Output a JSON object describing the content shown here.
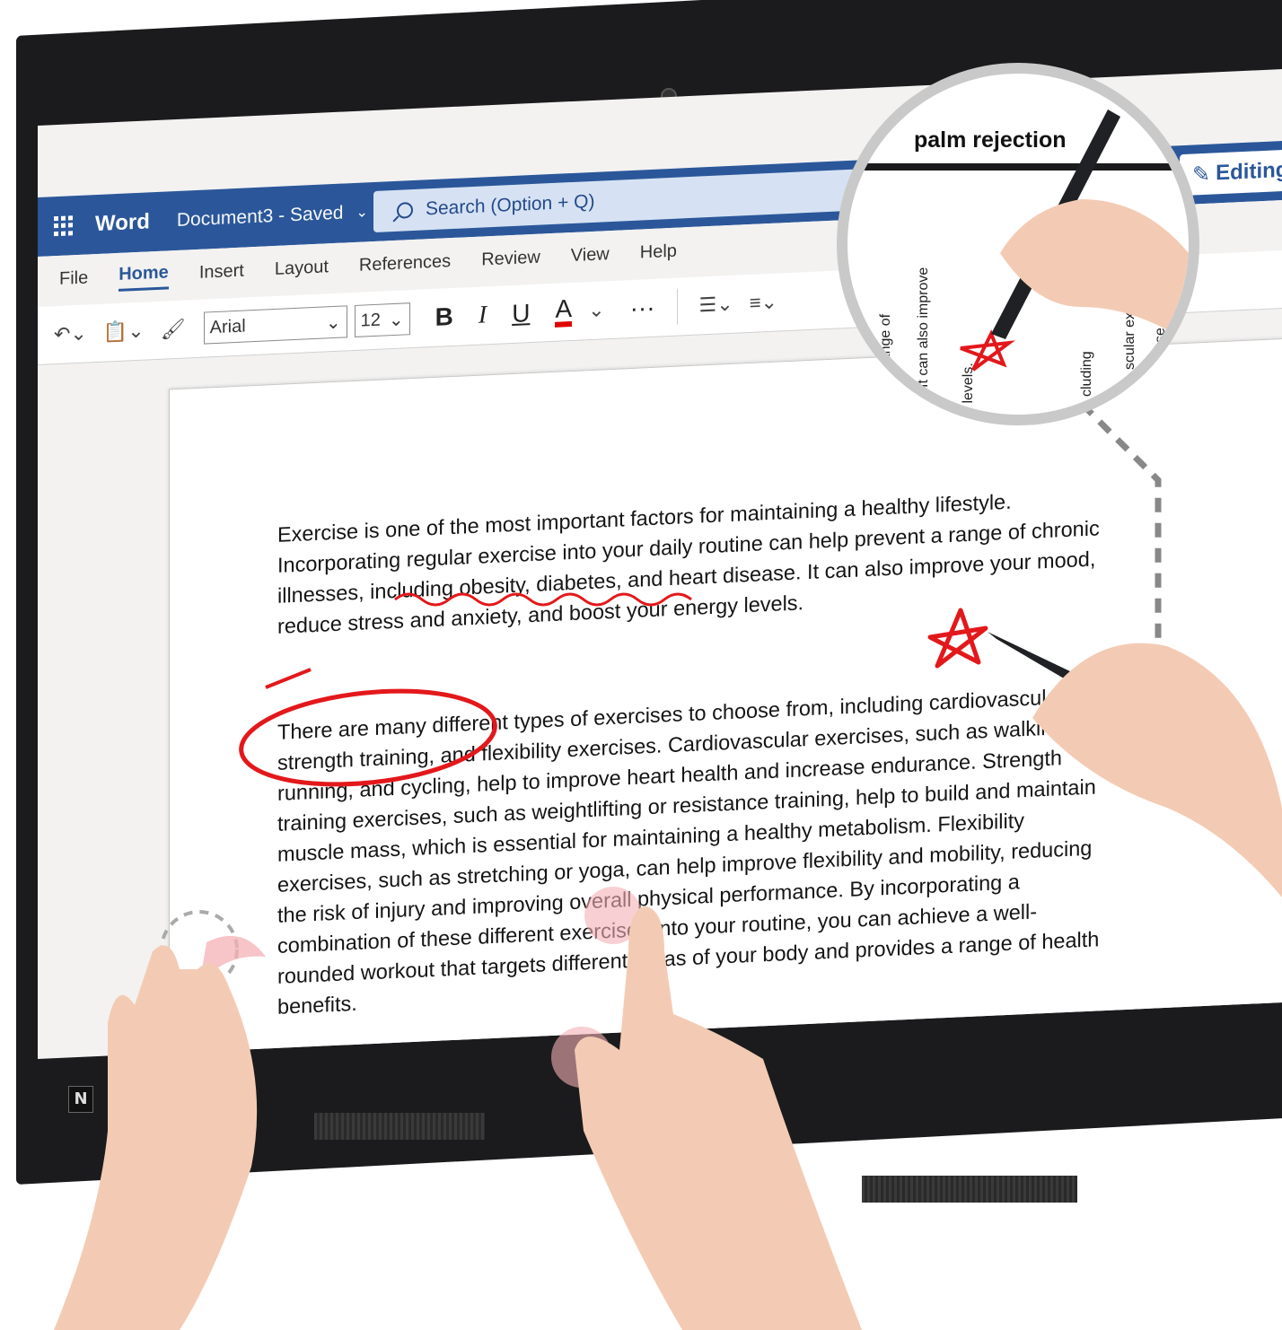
{
  "app": {
    "name": "Word",
    "document": "Document3 - Saved",
    "search_placeholder": "Search (Option + Q)",
    "mode": "Editing"
  },
  "ribbon": {
    "tabs": [
      "File",
      "Home",
      "Insert",
      "Layout",
      "References",
      "Review",
      "View",
      "Help"
    ],
    "active_tab": "Home",
    "font_name": "Arial",
    "font_size": "12",
    "bold": "B",
    "italic": "I",
    "underline": "U",
    "font_color": "A",
    "more": "···",
    "accent_color": "#2b579a",
    "font_color_swatch": "#e00000"
  },
  "document": {
    "paragraphs": [
      "Exercise is one of the most important factors for maintaining a healthy lifestyle. Incorporating regular exercise into your daily routine can help prevent a range of chronic illnesses, including obesity, diabetes, and heart disease. It can also improve your mood, reduce stress and anxiety, and boost your energy levels.",
      "There are many different types of exercises to choose from, including cardiovascular, strength training, and flexibility exercises. Cardiovascular exercises, such as walking, running, and cycling, help to improve heart health and increase endurance. Strength training exercises, such as weightlifting or resistance training, help to build and maintain muscle mass, which is essential for maintaining a healthy metabolism. Flexibility exercises, such as stretching or yoga, can help improve flexibility and mobility, reducing the risk of injury and improving overall physical performance. By incorporating a combination of these different exercises into your routine, you can achieve a well-rounded workout that targets different areas of your body and provides a range of health benefits.",
      "Exercise is one of the most important factors for maintaining a healthy lifestyle."
    ]
  },
  "callout": {
    "label": "palm rejection",
    "zoom_texts": [
      "a range of",
      "It can also improve",
      "y levels.",
      "cluding",
      "scular exercises,",
      "se"
    ]
  },
  "colors": {
    "ink": "#e3181b",
    "bezel": "#1b1b1d"
  }
}
